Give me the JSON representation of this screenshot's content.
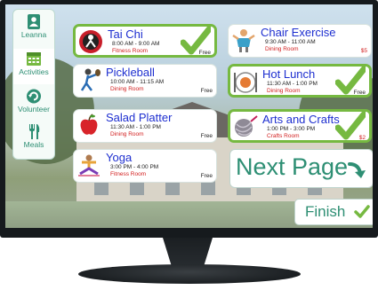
{
  "sidebar": {
    "items": [
      {
        "label": "Leanna",
        "icon": "contact-book-icon",
        "active": false
      },
      {
        "label": "Activities",
        "icon": "calendar-icon",
        "active": true
      },
      {
        "label": "Volunteer",
        "icon": "refresh-icon",
        "active": false
      },
      {
        "label": "Meals",
        "icon": "fork-knife-icon",
        "active": false
      }
    ]
  },
  "activities": [
    {
      "title": "Tai Chi",
      "time": "8:00 AM - 9:00 AM",
      "room": "Fitness Room",
      "price": "Free",
      "selected": true,
      "icon": "tai-chi-icon"
    },
    {
      "title": "Chair Exercise",
      "time": "9:30 AM - 11:00 AM",
      "room": "Dining Room",
      "price": "$5",
      "selected": false,
      "icon": "chair-exercise-icon"
    },
    {
      "title": "Pickleball",
      "time": "10:00 AM - 11:15 AM",
      "room": "Dining Room",
      "price": "Free",
      "selected": false,
      "icon": "pickleball-icon"
    },
    {
      "title": "Hot Lunch",
      "time": "11:30 AM - 1:00 PM",
      "room": "Dining Room",
      "price": "Free",
      "selected": true,
      "icon": "plate-icon"
    },
    {
      "title": "Salad Platter",
      "time": "11:30 AM - 1:00 PM",
      "room": "Dining Room",
      "price": "Free",
      "selected": false,
      "icon": "apple-icon"
    },
    {
      "title": "Arts and Crafts",
      "time": "1:00 PM - 3:00 PM",
      "room": "Crafts Room",
      "price": "$2",
      "selected": true,
      "icon": "yarn-icon"
    },
    {
      "title": "Yoga",
      "time": "3:00 PM - 4:00 PM",
      "room": "Fitness Room",
      "price": "Free",
      "selected": false,
      "icon": "yoga-icon"
    }
  ],
  "next_button": {
    "label": "Next Page"
  },
  "finish_button": {
    "label": "Finish"
  },
  "colors": {
    "accent": "#2e8f74",
    "check": "#76b941",
    "title": "#1e2fd0",
    "room": "#d21e1e"
  }
}
